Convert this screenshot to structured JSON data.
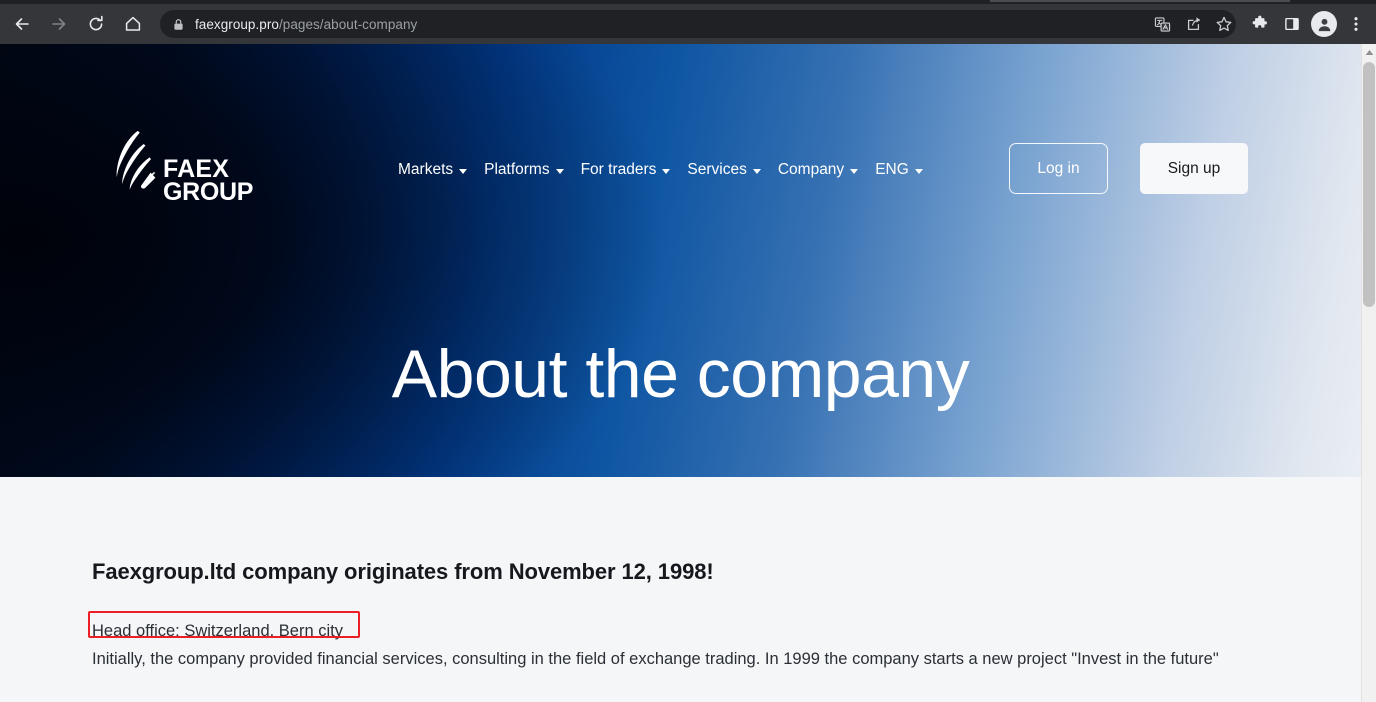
{
  "browser": {
    "nav": {
      "back_icon": "arrow-left-icon",
      "forward_icon": "arrow-right-icon",
      "reload_icon": "reload-icon",
      "home_icon": "home-icon"
    },
    "omnibox": {
      "lock_icon": "lock-icon",
      "url_domain": "faexgroup.pro",
      "url_path": "/pages/about-company",
      "full_url": "faexgroup.pro/pages/about-company",
      "translate_icon": "translate-icon",
      "share_icon": "share-icon",
      "bookmark_icon": "star-bookmark-icon"
    },
    "toolbar_right": {
      "extensions_icon": "puzzle-extensions-icon",
      "side_panel_icon": "side-panel-icon",
      "profile_icon": "profile-avatar-icon",
      "menu_icon": "three-dot-menu-icon"
    },
    "scrollbar": {
      "up_arrow_icon": "scroll-up-arrow-icon"
    }
  },
  "site": {
    "logo": {
      "line1": "FAEX",
      "line2": "GROUP",
      "wing_icon": "wing-feather-logo-icon"
    },
    "nav_items": [
      {
        "label": "Markets",
        "has_dropdown": true
      },
      {
        "label": "Platforms",
        "has_dropdown": true
      },
      {
        "label": "For traders",
        "has_dropdown": true
      },
      {
        "label": "Services",
        "has_dropdown": true
      },
      {
        "label": "Company",
        "has_dropdown": true
      },
      {
        "label": "ENG",
        "has_dropdown": true
      }
    ],
    "login_label": "Log in",
    "signup_label": "Sign up",
    "hero_title": "About the company"
  },
  "content": {
    "heading": "Faexgroup.ltd company originates from November 12, 1998!",
    "head_office": "Head office: Switzerland. Bern city",
    "paragraph": "Initially, the company provided financial services, consulting in the field of exchange trading. In 1999 the company starts a new project \"Invest in the future\""
  },
  "annotation": {
    "highlight_color": "#ec2024",
    "target": "Head office: Switzerland. Bern city"
  },
  "colors": {
    "chrome_bg": "#35363a",
    "omnibox_bg": "#202124",
    "hero_dark": "#010512",
    "hero_blue": "#0e55a2",
    "hero_light": "#eaeef4",
    "content_bg": "#f4f6f7",
    "text_dark": "#16181d"
  }
}
